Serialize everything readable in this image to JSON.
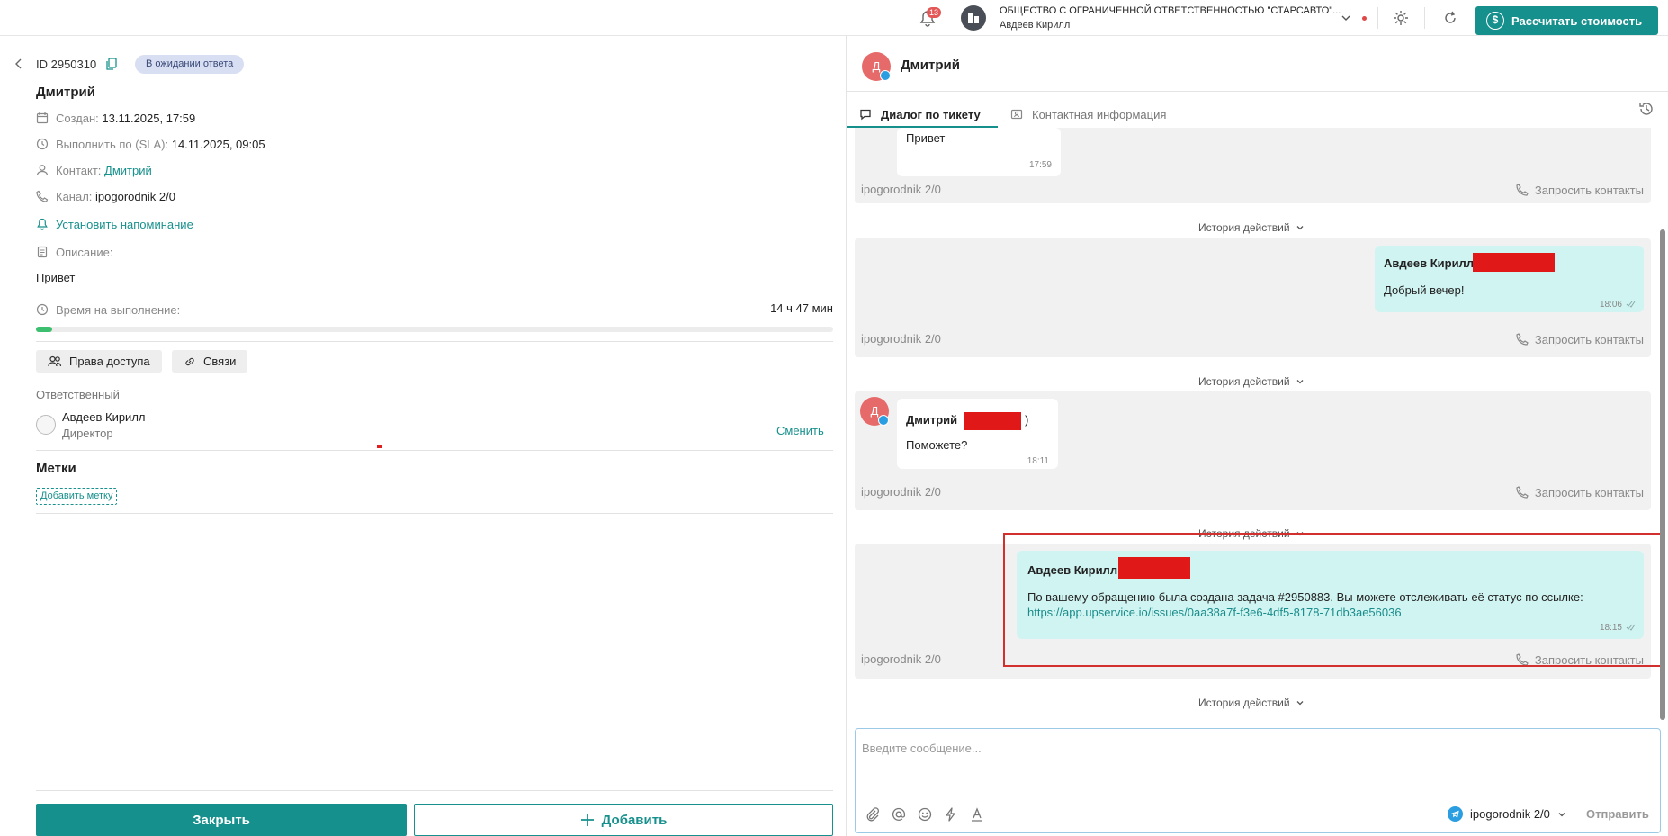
{
  "topbar": {
    "notification_count": "13",
    "org_name": "ОБЩЕСТВО С ОГРАНИЧЕННОЙ ОТВЕТСТВЕННОСТЬЮ \"СТАРСАВТО\"...",
    "user_name": "Авдеев Кирилл",
    "calc_button": "Рассчитать стоимость",
    "accent": "#15908c"
  },
  "ticket": {
    "id": "ID 2950310",
    "status": "В ожидании ответа",
    "title": "Дмитрий",
    "created_label": "Создан:",
    "created_value": "13.11.2025, 17:59",
    "sla_label": "Выполнить по (SLA):",
    "sla_value": "14.11.2025, 09:05",
    "contact_label": "Контакт:",
    "contact_value": "Дмитрий",
    "channel_label": "Канал:",
    "channel_value": "ipogorodnik 2/0",
    "reminder": "Установить напоминание",
    "description_label": "Описание:",
    "description": "Привет",
    "time_label": "Время на выполнение:",
    "time_value": "14 ч 47 мин",
    "time_progress_percent": 2,
    "access_button": "Права доступа",
    "links_button": "Связи",
    "responsible_label": "Ответственный",
    "responsible_name": "Авдеев Кирилл",
    "responsible_role": "Директор",
    "change_link": "Сменить",
    "tags_title": "Метки",
    "add_tag": "Добавить метку",
    "close_button": "Закрыть",
    "add_button": "Добавить"
  },
  "chat": {
    "avatar_letter": "Д",
    "name": "Дмитрий",
    "tab_dialog": "Диалог по тикету",
    "tab_contact": "Контактная информация",
    "channel": "ipogorodnik 2/0",
    "request_contacts": "Запросить контакты",
    "history": "История действий",
    "msg0_text": "Привет",
    "msg0_time": "17:59",
    "msg1_author": "Авдеев Кирилл",
    "msg1_text": "Добрый вечер!",
    "msg1_time": "18:06",
    "msg2_author": "Дмитрий",
    "msg2_author_suffix": ")",
    "msg2_text": "Поможете?",
    "msg2_time": "18:11",
    "msg3_author": "Авдеев Кирилл",
    "msg3_text": "По вашему обращению была создана задача #2950883. Вы можете отслеживать её статус по ссылке:",
    "msg3_link": "https://app.upservice.io/issues/0aa38a7f-f3e6-4df5-8178-71db3ae56036",
    "msg3_time": "18:15",
    "composer_placeholder": "Введите сообщение...",
    "composer_channel": "ipogorodnik 2/0",
    "send": "Отправить"
  },
  "icons": [
    "bell-icon",
    "org-icon",
    "chevron-down-icon",
    "gear-icon",
    "refresh-icon",
    "dollar-icon",
    "back-icon",
    "copy-icon",
    "calendar-icon",
    "clock-icon",
    "person-icon",
    "phone-icon",
    "bell-outline-icon",
    "document-icon",
    "people-icon",
    "link-icon",
    "plus-icon",
    "chat-icon",
    "contact-card-icon",
    "history-icon",
    "telegram-icon",
    "phone-request-icon",
    "double-check-icon",
    "paperclip-icon",
    "at-icon",
    "emoji-icon",
    "lightning-icon",
    "text-format-icon"
  ]
}
